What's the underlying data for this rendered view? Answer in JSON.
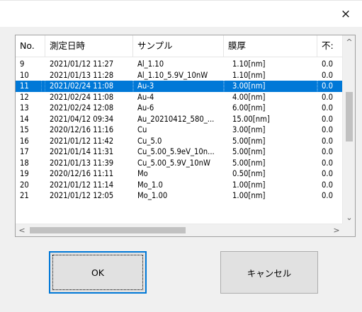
{
  "dialog": {
    "close_glyph": "×"
  },
  "table": {
    "headers": [
      "No.",
      "測定日時",
      "サンプル",
      "膜厚",
      "不:"
    ],
    "selected_index": 2,
    "rows": [
      [
        "9",
        "2021/01/12 11:27",
        "Al_1.10",
        "1.10[nm]",
        "0.0"
      ],
      [
        "10",
        "2021/01/13 11:28",
        "Al_1.10_5.9V_10nW",
        "1.10[nm]",
        "0.0"
      ],
      [
        "11",
        "2021/02/24 11:08",
        "Au-3",
        "3.00[nm]",
        "0.0"
      ],
      [
        "12",
        "2021/02/24 11:08",
        "Au-4",
        "4.00[nm]",
        "0.0"
      ],
      [
        "13",
        "2021/02/24 12:08",
        "Au-6",
        "6.00[nm]",
        "0.0"
      ],
      [
        "14",
        "2021/04/12 09:34",
        "Au_20210412_580_...",
        "15.00[nm]",
        "0.0"
      ],
      [
        "15",
        "2020/12/16 11:16",
        "Cu",
        "3.00[nm]",
        "0.0"
      ],
      [
        "16",
        "2021/01/12 11:42",
        "Cu_5.0",
        "5.00[nm]",
        "0.0"
      ],
      [
        "17",
        "2021/01/14 11:31",
        "Cu_5.00_5.9eV_10n...",
        "5.00[nm]",
        "0.0"
      ],
      [
        "18",
        "2021/01/13 11:39",
        "Cu_5.00_5.9V_10nW",
        "5.00[nm]",
        "0.0"
      ],
      [
        "19",
        "2020/12/16 11:11",
        "Mo",
        "0.50[nm]",
        "0.0"
      ],
      [
        "20",
        "2021/01/12 11:14",
        "Mo_1.0",
        "1.00[nm]",
        "0.0"
      ],
      [
        "21",
        "2021/01/12 12:05",
        "Mo_1.00",
        "1.00[nm]",
        "0.0"
      ]
    ]
  },
  "scroll": {
    "up": "^",
    "down": "⌄",
    "left": "<",
    "right": ">"
  },
  "buttons": {
    "ok": "OK",
    "cancel": "キャンセル"
  },
  "colors": {
    "selection": "#0078d7",
    "focus_border": "#0078d7"
  }
}
